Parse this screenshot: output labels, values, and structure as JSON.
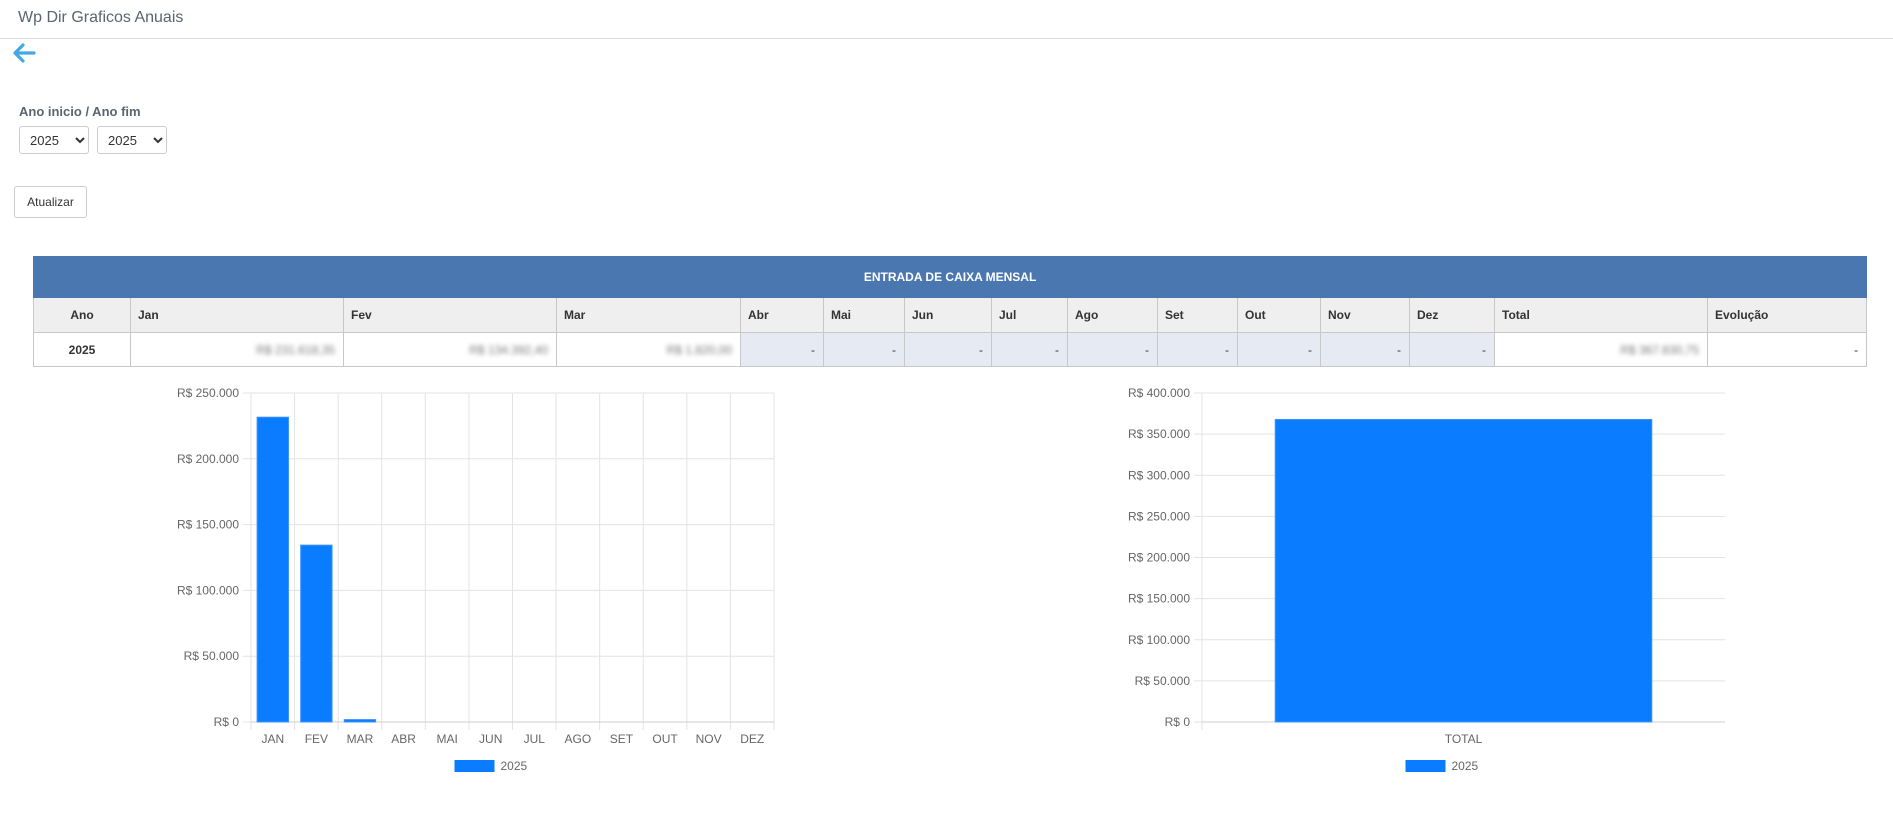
{
  "header": {
    "title": "Wp Dir Graficos Anuais"
  },
  "filters": {
    "label": "Ano inicio / Ano fim",
    "start_year": "2025",
    "end_year": "2025",
    "update_label": "Atualizar"
  },
  "table": {
    "caption": "ENTRADA DE CAIXA MENSAL",
    "headers": [
      "Ano",
      "Jan",
      "Fev",
      "Mar",
      "Abr",
      "Mai",
      "Jun",
      "Jul",
      "Ago",
      "Set",
      "Out",
      "Nov",
      "Dez",
      "Total",
      "Evolução"
    ],
    "row": {
      "year": "2025",
      "jan": "R$ 231.618,35",
      "fev": "R$ 134.392,40",
      "mar": "R$ 1.820,00",
      "abr": "-",
      "mai": "-",
      "jun": "-",
      "jul": "-",
      "ago": "-",
      "set": "-",
      "out": "-",
      "nov": "-",
      "dez": "-",
      "total": "R$ 367.830,75",
      "evolucao": "-"
    }
  },
  "colors": {
    "bar": "#0a7cff",
    "table_header": "#4a77b0",
    "shade": "#e6ebf3"
  },
  "chart_data": [
    {
      "type": "bar",
      "categories": [
        "JAN",
        "FEV",
        "MAR",
        "ABR",
        "MAI",
        "JUN",
        "JUL",
        "AGO",
        "SET",
        "OUT",
        "NOV",
        "DEZ"
      ],
      "series": [
        {
          "name": "2025",
          "values": [
            231618,
            134392,
            1820,
            0,
            0,
            0,
            0,
            0,
            0,
            0,
            0,
            0
          ]
        }
      ],
      "ylim": [
        0,
        250000
      ],
      "yticks": [
        0,
        50000,
        100000,
        150000,
        200000,
        250000
      ],
      "ytick_labels": [
        "R$ 0",
        "R$ 50.000",
        "R$ 100.000",
        "R$ 150.000",
        "R$ 200.000",
        "R$ 250.000"
      ],
      "grid": true,
      "legend": "bottom"
    },
    {
      "type": "bar",
      "categories": [
        "TOTAL"
      ],
      "series": [
        {
          "name": "2025",
          "values": [
            367831
          ]
        }
      ],
      "ylim": [
        0,
        400000
      ],
      "yticks": [
        0,
        50000,
        100000,
        150000,
        200000,
        250000,
        300000,
        350000,
        400000
      ],
      "ytick_labels": [
        "R$ 0",
        "R$ 50.000",
        "R$ 100.000",
        "R$ 150.000",
        "R$ 200.000",
        "R$ 250.000",
        "R$ 300.000",
        "R$ 350.000",
        "R$ 400.000"
      ],
      "grid": true,
      "legend": "bottom"
    }
  ]
}
